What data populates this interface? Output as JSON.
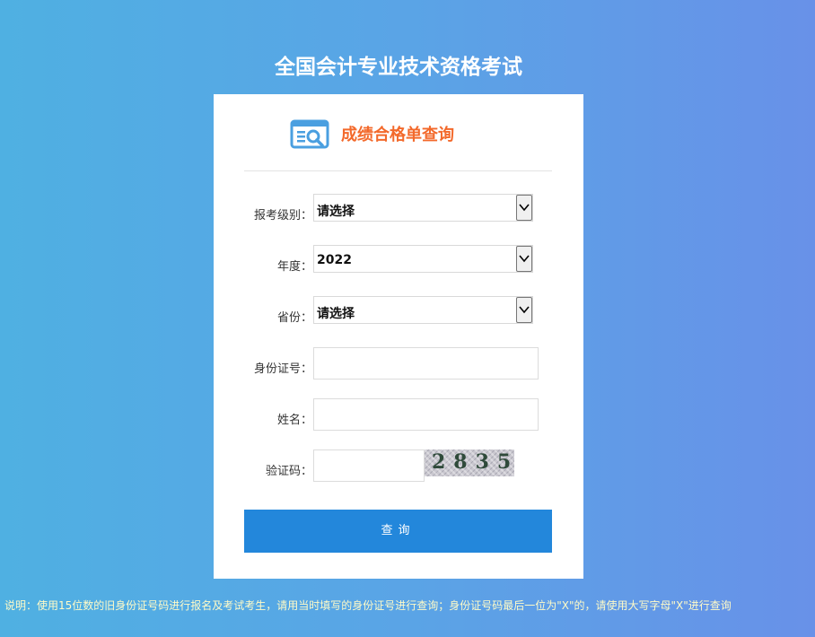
{
  "page": {
    "title": "全国会计专业技术资格考试"
  },
  "card": {
    "title": "成绩合格单查询",
    "icon": "search-document-icon",
    "accent_color": "#f3692b",
    "button_color": "#2387db"
  },
  "form": {
    "level": {
      "label": "报考级别：",
      "value": "请选择"
    },
    "year": {
      "label": "年度：",
      "value": "2022"
    },
    "province": {
      "label": "省份：",
      "value": "请选择"
    },
    "id_number": {
      "label": "身份证号：",
      "value": ""
    },
    "name": {
      "label": "姓名：",
      "value": ""
    },
    "captcha": {
      "label": "验证码：",
      "value": "",
      "image_text": "2835"
    },
    "submit_label": "查询"
  },
  "note": "说明：使用15位数的旧身份证号码进行报名及考试考生，请用当时填写的身份证号进行查询；身份证号码最后一位为\"X\"的，请使用大写字母\"X\"进行查询"
}
